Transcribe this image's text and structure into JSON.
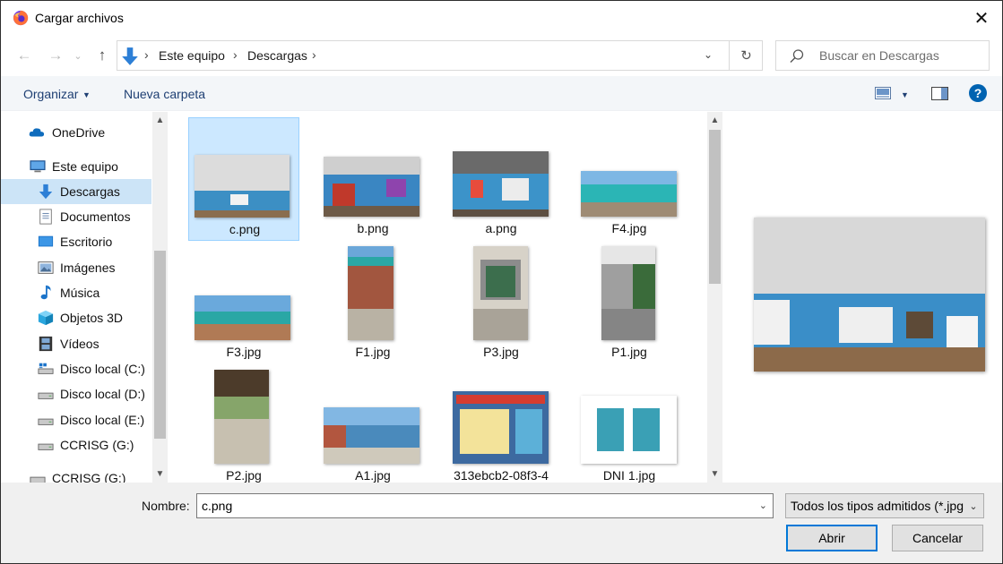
{
  "window": {
    "title": "Cargar archivos",
    "close_glyph": "✕"
  },
  "nav": {
    "back_glyph": "←",
    "forward_glyph": "→",
    "recent_glyph": "⌄",
    "up_glyph": "↑"
  },
  "address": {
    "crumbs": [
      "Este equipo",
      "Descargas"
    ],
    "separator": "›",
    "dropdown_glyph": "⌄",
    "refresh_glyph": "↻"
  },
  "search": {
    "placeholder": "Buscar en Descargas"
  },
  "toolbar": {
    "organize_label": "Organizar",
    "new_folder_label": "Nueva carpeta",
    "help_glyph": "?"
  },
  "sidebar": {
    "items": [
      {
        "label": "OneDrive",
        "icon": "cloud-icon"
      },
      {
        "label": "Este equipo",
        "icon": "computer-icon"
      },
      {
        "label": "Descargas",
        "icon": "download-arrow-icon",
        "selected": true
      },
      {
        "label": "Documentos",
        "icon": "document-icon"
      },
      {
        "label": "Escritorio",
        "icon": "desktop-icon"
      },
      {
        "label": "Imágenes",
        "icon": "pictures-icon"
      },
      {
        "label": "Música",
        "icon": "music-note-icon"
      },
      {
        "label": "Objetos 3D",
        "icon": "cube-icon"
      },
      {
        "label": "Vídeos",
        "icon": "film-icon"
      },
      {
        "label": "Disco local (C:)",
        "icon": "windows-drive-icon"
      },
      {
        "label": "Disco local (D:)",
        "icon": "drive-icon"
      },
      {
        "label": "Disco local (E:)",
        "icon": "drive-icon"
      },
      {
        "label": "CCRISG (G:)",
        "icon": "drive-icon"
      },
      {
        "label": "CCRISG (G:)",
        "icon": "usb-drive-icon"
      }
    ]
  },
  "files": [
    {
      "name": "c.png",
      "selected": true
    },
    {
      "name": "b.png"
    },
    {
      "name": "a.png"
    },
    {
      "name": "F4.jpg"
    },
    {
      "name": "F3.jpg"
    },
    {
      "name": "F1.jpg"
    },
    {
      "name": "P3.jpg"
    },
    {
      "name": "P1.jpg"
    },
    {
      "name": "P2.jpg"
    },
    {
      "name": "A1.jpg"
    },
    {
      "name": "313ebcb2-08f3-4"
    },
    {
      "name": "DNI 1.jpg"
    }
  ],
  "footer": {
    "name_label": "Nombre:",
    "name_value": "c.png",
    "filter_value": "Todos los tipos admitidos (*.jpg",
    "open_label": "Abrir",
    "cancel_label": "Cancelar",
    "dropdown_glyph": "⌄"
  },
  "colors": {
    "selection": "#cce8ff",
    "nav_selection": "#cce4f7",
    "link_text": "#1e3f73",
    "primary_border": "#0078d7",
    "help_blue": "#0063b1"
  }
}
